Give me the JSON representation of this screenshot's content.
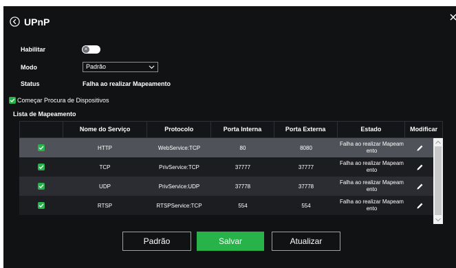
{
  "title": "UPnP",
  "form": {
    "enable_label": "Habilitar",
    "mode_label": "Modo",
    "mode_value": "Padrão",
    "status_label": "Status",
    "status_value": "Falha ao realizar Mapeamento",
    "discovery_label": "Começar Procura de Dispositivos",
    "mapping_list_label": "Lista de Mapeamento"
  },
  "table": {
    "headers": [
      "",
      "Nome do Serviço",
      "Protocolo",
      "Porta Interna",
      "Porta Externa",
      "Estado",
      "Modificar"
    ],
    "rows": [
      {
        "name": "HTTP",
        "protocol": "WebService:TCP",
        "internal": "80",
        "external": "8080",
        "state": "Falha ao realizar Mapeam ento"
      },
      {
        "name": "TCP",
        "protocol": "PrivService:TCP",
        "internal": "37777",
        "external": "37777",
        "state": "Falha ao realizar Mapeam ento"
      },
      {
        "name": "UDP",
        "protocol": "PrivService:UDP",
        "internal": "37778",
        "external": "37778",
        "state": "Falha ao realizar Mapeam ento"
      },
      {
        "name": "RTSP",
        "protocol": "RTSPService:TCP",
        "internal": "554",
        "external": "554",
        "state": "Falha ao realizar Mapeam ento"
      }
    ]
  },
  "buttons": {
    "default": "Padrão",
    "save": "Salvar",
    "refresh": "Atualizar"
  },
  "colors": {
    "accent": "#27b24a",
    "background": "#111214"
  }
}
